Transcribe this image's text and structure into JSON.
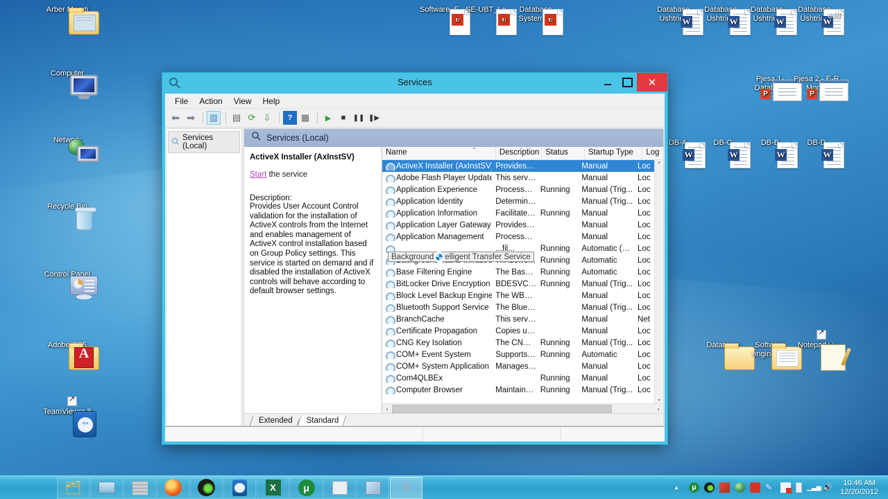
{
  "desktop": {
    "icons_left": [
      {
        "label": "Arber Murati",
        "type": "folder-user"
      },
      {
        "label": "Computer",
        "type": "computer"
      },
      {
        "label": "Network",
        "type": "network"
      },
      {
        "label": "Recycle Bin",
        "type": "recycle-bin"
      },
      {
        "label": "Control Panel",
        "type": "control-panel"
      },
      {
        "label": "Adobe CS5",
        "type": "folder-adobe"
      },
      {
        "label": "TeamViewer 8",
        "type": "teamviewer"
      }
    ],
    "icons_top_center": [
      {
        "label": "Software_E...",
        "type": "pdf"
      },
      {
        "label": "SE-UBT_Le...",
        "type": "pdf"
      },
      {
        "label": "Database System ...",
        "type": "pdf"
      }
    ],
    "icons_top_right": [
      {
        "label": "Database - Ushtrim...",
        "type": "word"
      },
      {
        "label": "Database - Ushtrim...",
        "type": "word"
      },
      {
        "label": "Database - Ushtrim...",
        "type": "word"
      },
      {
        "label": "Database - Ushtrim...",
        "type": "word"
      }
    ],
    "icons_right_mid": [
      {
        "label": "Pjesa 1- Databa...",
        "type": "powerpoint"
      },
      {
        "label": "Pjesa 2 - E-R Model",
        "type": "powerpoint"
      },
      {
        "label": "DB-A",
        "type": "word"
      },
      {
        "label": "DB-C",
        "type": "word"
      },
      {
        "label": "DB-B",
        "type": "word"
      },
      {
        "label": "DB-D",
        "type": "word"
      }
    ],
    "icons_bottom_right": [
      {
        "label": "Database",
        "type": "folder"
      },
      {
        "label": "Software enginering",
        "type": "folder"
      },
      {
        "label": "Notepad++",
        "type": "notepadpp"
      }
    ],
    "clipped_text": "add"
  },
  "window": {
    "title": "Services",
    "titlebar_icon": "services-icon",
    "controls": {
      "minimize": "minimize-icon",
      "maximize": "maximize-icon",
      "close": "✕"
    },
    "menu": [
      "File",
      "Action",
      "View",
      "Help"
    ],
    "toolbar": [
      {
        "name": "back-icon",
        "glyph": "⬅"
      },
      {
        "name": "forward-icon",
        "glyph": "➡"
      },
      {
        "name": "show-hide-console-tree-icon",
        "glyph": "▥",
        "selected": true
      },
      {
        "name": "properties-icon",
        "glyph": "▤"
      },
      {
        "name": "refresh-icon",
        "glyph": "⟳"
      },
      {
        "name": "export-list-icon",
        "glyph": "⇩"
      },
      {
        "name": "help-icon",
        "glyph": "?"
      },
      {
        "name": "show-hide-action-pane-icon",
        "glyph": "▦"
      },
      {
        "name": "start-service-icon",
        "glyph": "▶"
      },
      {
        "name": "stop-service-icon",
        "glyph": "■"
      },
      {
        "name": "pause-service-icon",
        "glyph": "❚❚"
      },
      {
        "name": "restart-service-icon",
        "glyph": "❚▶"
      }
    ],
    "tree": {
      "root_label": "Services (Local)"
    },
    "main_header": "Services (Local)",
    "detail": {
      "title": "ActiveX Installer (AxInstSV)",
      "action_link": "Start",
      "action_suffix": " the service",
      "description_label": "Description:",
      "description": "Provides User Account Control validation for the installation of ActiveX controls from the Internet and enables management of ActiveX control installation based on Group Policy settings. This service is started on demand and if disabled the installation of ActiveX controls will behave according to default browser settings."
    },
    "columns": [
      "Name",
      "Description",
      "Status",
      "Startup Type",
      "Log"
    ],
    "sorted_column": "Name",
    "rows": [
      {
        "name": "ActiveX Installer (AxInstSV)",
        "description": "Provides Us...",
        "status": "",
        "startup": "Manual",
        "logon": "Loc",
        "selected": true
      },
      {
        "name": "Adobe Flash Player Update ...",
        "description": "This service ...",
        "status": "",
        "startup": "Manual",
        "logon": "Loc"
      },
      {
        "name": "Application Experience",
        "description": "Processes a...",
        "status": "Running",
        "startup": "Manual (Trig...",
        "logon": "Loc"
      },
      {
        "name": "Application Identity",
        "description": "Determines ...",
        "status": "",
        "startup": "Manual (Trig...",
        "logon": "Loc"
      },
      {
        "name": "Application Information",
        "description": "Facilitates t...",
        "status": "Running",
        "startup": "Manual",
        "logon": "Loc"
      },
      {
        "name": "Application Layer Gateway ...",
        "description": "Provides su...",
        "status": "",
        "startup": "Manual",
        "logon": "Loc"
      },
      {
        "name": "Application Management",
        "description": "Processes in...",
        "status": "",
        "startup": "Manual",
        "logon": "Loc"
      },
      {
        "name": "Background Intelligent Tran...",
        "description": "...fil...",
        "status": "Running",
        "startup": "Automatic (D...",
        "logon": "Loc",
        "hovered": true
      },
      {
        "name": "Background Tasks Infrastru...",
        "description": "Windows in...",
        "status": "Running",
        "startup": "Automatic",
        "logon": "Loc"
      },
      {
        "name": "Base Filtering Engine",
        "description": "The Base Fil...",
        "status": "Running",
        "startup": "Automatic",
        "logon": "Loc"
      },
      {
        "name": "BitLocker Drive Encryption ...",
        "description": "BDESVC hos...",
        "status": "Running",
        "startup": "Manual (Trig...",
        "logon": "Loc"
      },
      {
        "name": "Block Level Backup Engine ...",
        "description": "The WBENG...",
        "status": "",
        "startup": "Manual",
        "logon": "Loc"
      },
      {
        "name": "Bluetooth Support Service",
        "description": "The Bluetoo...",
        "status": "",
        "startup": "Manual (Trig...",
        "logon": "Loc"
      },
      {
        "name": "BranchCache",
        "description": "This service ...",
        "status": "",
        "startup": "Manual",
        "logon": "Net"
      },
      {
        "name": "Certificate Propagation",
        "description": "Copies user ...",
        "status": "",
        "startup": "Manual",
        "logon": "Loc"
      },
      {
        "name": "CNG Key Isolation",
        "description": "The CNG ke...",
        "status": "Running",
        "startup": "Manual (Trig...",
        "logon": "Loc"
      },
      {
        "name": "COM+ Event System",
        "description": "Supports Sy...",
        "status": "Running",
        "startup": "Automatic",
        "logon": "Loc"
      },
      {
        "name": "COM+ System Application",
        "description": "Manages th...",
        "status": "",
        "startup": "Manual",
        "logon": "Loc"
      },
      {
        "name": "Com4QLBEx",
        "description": "",
        "status": "Running",
        "startup": "Manual",
        "logon": "Loc"
      },
      {
        "name": "Computer Browser",
        "description": "Maintains a...",
        "status": "Running",
        "startup": "Manual (Trig...",
        "logon": "Loc"
      }
    ],
    "tooltip": "Background Intelligent Transfer Service",
    "tabs": [
      {
        "label": "Extended",
        "active": false
      },
      {
        "label": "Standard",
        "active": true
      }
    ],
    "scroll": {
      "h_arrow_left": "‹",
      "h_arrow_right": "›",
      "v_arrow_up": "⌃",
      "v_arrow_down": "⌄"
    }
  },
  "taskbar": {
    "buttons": [
      {
        "name": "file-explorer",
        "glyph": "🗂"
      },
      {
        "name": "windows-media-player",
        "glyph": "▭"
      },
      {
        "name": "calculator-or-app",
        "glyph": "▩"
      },
      {
        "name": "firefox",
        "glyph": "◉"
      },
      {
        "name": "opera-or-media",
        "glyph": "◍"
      },
      {
        "name": "teamviewer",
        "glyph": "⇔"
      },
      {
        "name": "excel",
        "glyph": "X"
      },
      {
        "name": "utorrent",
        "glyph": "μ"
      },
      {
        "name": "printer-app",
        "glyph": "🖶"
      },
      {
        "name": "notepad-app",
        "glyph": "▤"
      },
      {
        "name": "services-window",
        "glyph": "⚙",
        "active": true
      }
    ],
    "tray": [
      {
        "name": "show-hidden-icons",
        "glyph": "▲"
      },
      {
        "name": "utorrent-tray-icon",
        "glyph": "μ"
      },
      {
        "name": "media-tray-icon",
        "glyph": "◍"
      },
      {
        "name": "network-flag-icon",
        "glyph": "⚑"
      },
      {
        "name": "globe-tray-icon",
        "glyph": "●"
      },
      {
        "name": "shield-tray-icon",
        "glyph": "◆"
      },
      {
        "name": "pen-tray-icon",
        "glyph": "✎"
      },
      {
        "name": "action-center-icon",
        "glyph": "⚐"
      },
      {
        "name": "battery-icon",
        "glyph": "▯"
      },
      {
        "name": "signal-icon",
        "glyph": "▂▄▆"
      },
      {
        "name": "volume-icon",
        "glyph": "🔊"
      }
    ],
    "clock": {
      "time": "10:46 AM",
      "date": "12/20/2012"
    }
  }
}
